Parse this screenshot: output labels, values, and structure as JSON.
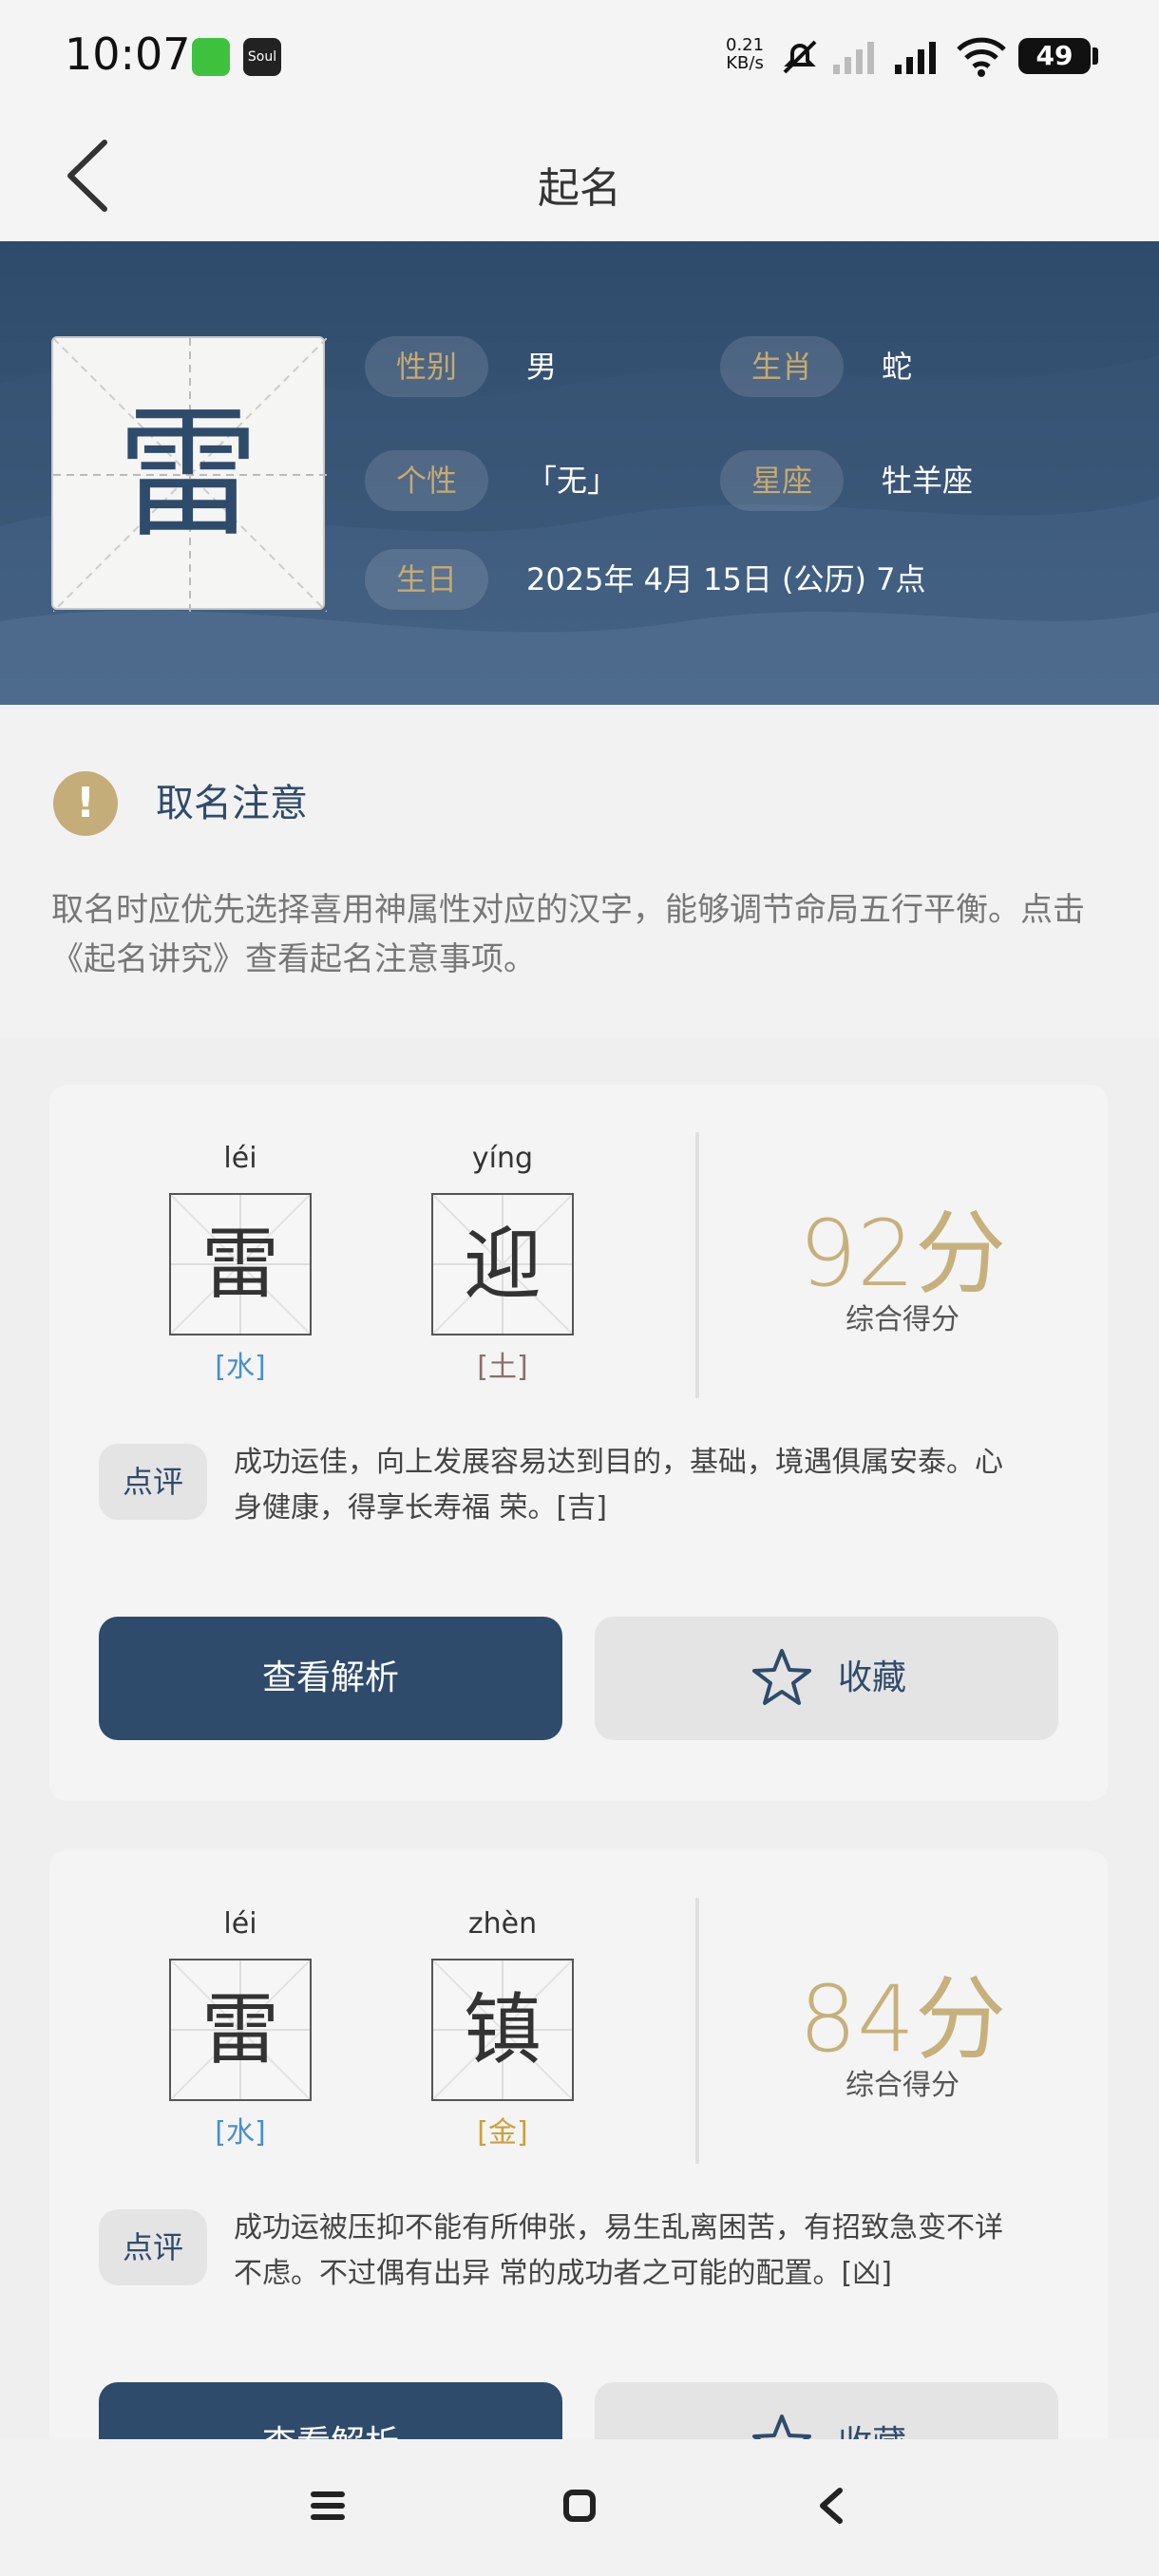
{
  "status_bar": {
    "time": "10:07",
    "net_speed_value": "0.21",
    "net_speed_unit": "KB/s",
    "battery": "49",
    "apps": [
      "wechat-icon",
      "soul-icon"
    ],
    "soul_label": "Soul"
  },
  "header": {
    "title": "起名"
  },
  "profile": {
    "char": "雷",
    "rows": [
      {
        "label": "性别",
        "value": "男"
      },
      {
        "label": "生肖",
        "value": "蛇"
      },
      {
        "label": "个性",
        "value": "「无」"
      },
      {
        "label": "星座",
        "value": "牡羊座"
      },
      {
        "label": "生日",
        "value": "2025年 4月 15日 (公历) 7点"
      }
    ]
  },
  "notice": {
    "icon": "!",
    "title": "取名注意",
    "text": "取名时应优先选择喜用神属性对应的汉字，能够调节命局五行平衡。点击《起名讲究》查看起名注意事项。"
  },
  "cards": [
    {
      "chars": [
        {
          "pinyin": "léi",
          "char": "雷",
          "element": "[水]"
        },
        {
          "pinyin": "yíng",
          "char": "迎",
          "element": "[土]"
        }
      ],
      "score": "92分",
      "score_label": "综合得分",
      "comment_tag": "点评",
      "comment": "成功运佳，向上发展容易达到目的，基础，境遇俱属安泰。心身健康，得享长寿福 荣。[吉]",
      "view_button": "查看解析",
      "fav_button": "收藏"
    },
    {
      "chars": [
        {
          "pinyin": "léi",
          "char": "雷",
          "element": "[水]"
        },
        {
          "pinyin": "zhèn",
          "char": "镇",
          "element": "[金]"
        }
      ],
      "score": "84分",
      "score_label": "综合得分",
      "comment_tag": "点评",
      "comment": "成功运被压抑不能有所伸张，易生乱离困苦，有招致急变不详不虑。不过偶有出异 常的成功者之可能的配置。[凶]",
      "view_button": "查看解析",
      "fav_button": "收藏"
    }
  ],
  "colors": {
    "primary": "#2f4b6b",
    "gold": "#c6b17c",
    "water": "#4a90c8",
    "earth": "#8c6e6e",
    "metal": "#c9a23c"
  }
}
